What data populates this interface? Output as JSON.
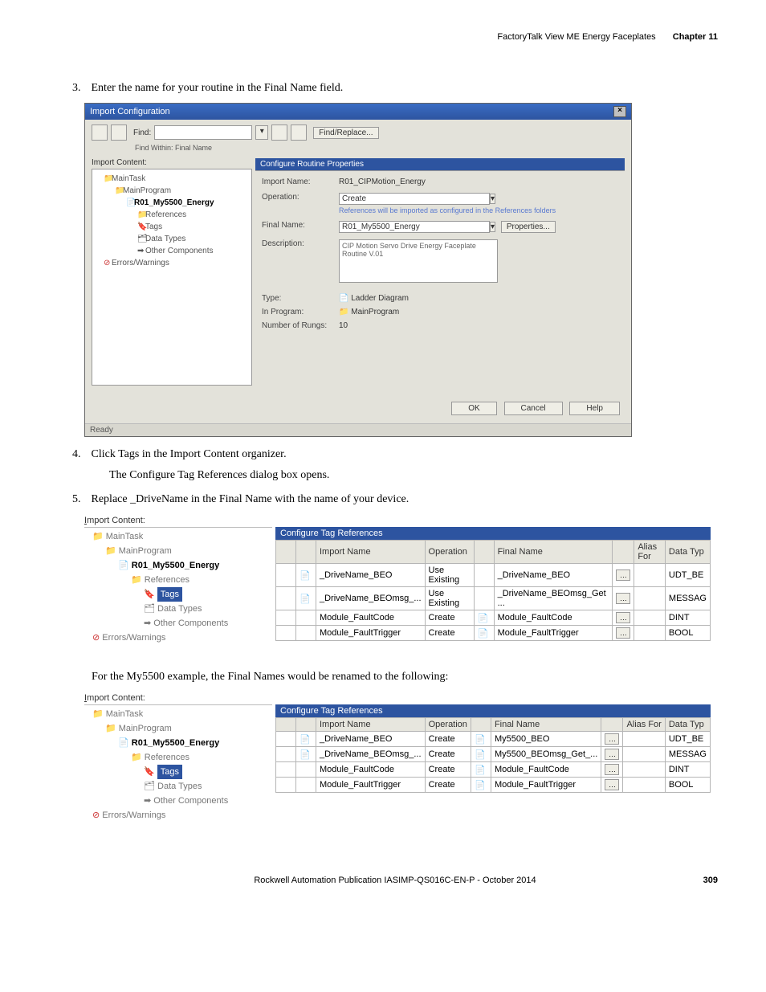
{
  "header": {
    "title": "FactoryTalk View ME Energy Faceplates",
    "chapter": "Chapter 11"
  },
  "steps": {
    "s3": "Enter the name for your routine in the Final Name field.",
    "s4": "Click Tags in the Import Content organizer.",
    "s4b": "The Configure Tag References dialog box opens.",
    "s5": "Replace _DriveName in the Final Name with the name of your device.",
    "note": "For the My5500 example, the Final Names would be renamed to the following:"
  },
  "dialog1": {
    "title": "Import Configuration",
    "findLabel": "Find:",
    "findReplace": "Find/Replace...",
    "findWithin": "Find Within: Final Name",
    "importContentLabel": "Import Content:",
    "tree": {
      "root": "MainTask",
      "prog": "MainProgram",
      "routine": "R01_My5500_Energy",
      "refs": "References",
      "tags": "Tags",
      "types": "Data Types",
      "other": "Other Components",
      "errs": "Errors/Warnings"
    },
    "propHeader": "Configure Routine Properties",
    "rows": {
      "importNameL": "Import Name:",
      "importNameV": "R01_CIPMotion_Energy",
      "operationL": "Operation:",
      "operationV": "Create",
      "opWarn": "References will be imported as configured in the References folders",
      "finalNameL": "Final Name:",
      "finalNameV": "R01_My5500_Energy",
      "propBtn": "Properties...",
      "descL": "Description:",
      "descV": "CIP Motion Servo Drive Energy Faceplate Routine V.01",
      "typeL": "Type:",
      "typeV": "Ladder Diagram",
      "inProgL": "In Program:",
      "inProgV": "MainProgram",
      "rungsL": "Number of Rungs:",
      "rungsV": "10"
    },
    "buttons": {
      "ok": "OK",
      "cancel": "Cancel",
      "help": "Help"
    },
    "status": "Ready"
  },
  "grid_common": {
    "icTitle": "Import Content:",
    "tree": {
      "root": "MainTask",
      "prog": "MainProgram",
      "routine": "R01_My5500_Energy",
      "refs": "References",
      "tags": "Tags",
      "types": "Data Types",
      "other": "Other Components",
      "errs": "Errors/Warnings"
    },
    "header": "Configure Tag References",
    "cols": {
      "import": "Import Name",
      "op": "Operation",
      "final": "Final Name",
      "alias": "Alias For",
      "type": "Data Typ"
    }
  },
  "grid1_rows": [
    {
      "import": "_DriveName_BEO",
      "op": "Use Existing",
      "final": "_DriveName_BEO",
      "type": "UDT_BE"
    },
    {
      "import": "_DriveName_BEOmsg_...",
      "op": "Use Existing",
      "final": "_DriveName_BEOmsg_Get ...",
      "type": "MESSAG"
    },
    {
      "import": "Module_FaultCode",
      "op": "Create",
      "final": "Module_FaultCode",
      "type": "DINT"
    },
    {
      "import": "Module_FaultTrigger",
      "op": "Create",
      "final": "Module_FaultTrigger",
      "type": "BOOL"
    }
  ],
  "grid2_rows": [
    {
      "import": "_DriveName_BEO",
      "op": "Create",
      "final": "My5500_BEO",
      "type": "UDT_BE"
    },
    {
      "import": "_DriveName_BEOmsg_...",
      "op": "Create",
      "final": "My5500_BEOmsg_Get_...",
      "type": "MESSAG"
    },
    {
      "import": "Module_FaultCode",
      "op": "Create",
      "final": "Module_FaultCode",
      "type": "DINT"
    },
    {
      "import": "Module_FaultTrigger",
      "op": "Create",
      "final": "Module_FaultTrigger",
      "type": "BOOL"
    }
  ],
  "footer": {
    "pub": "Rockwell Automation Publication IASIMP-QS016C-EN-P - October 2014",
    "page": "309"
  }
}
